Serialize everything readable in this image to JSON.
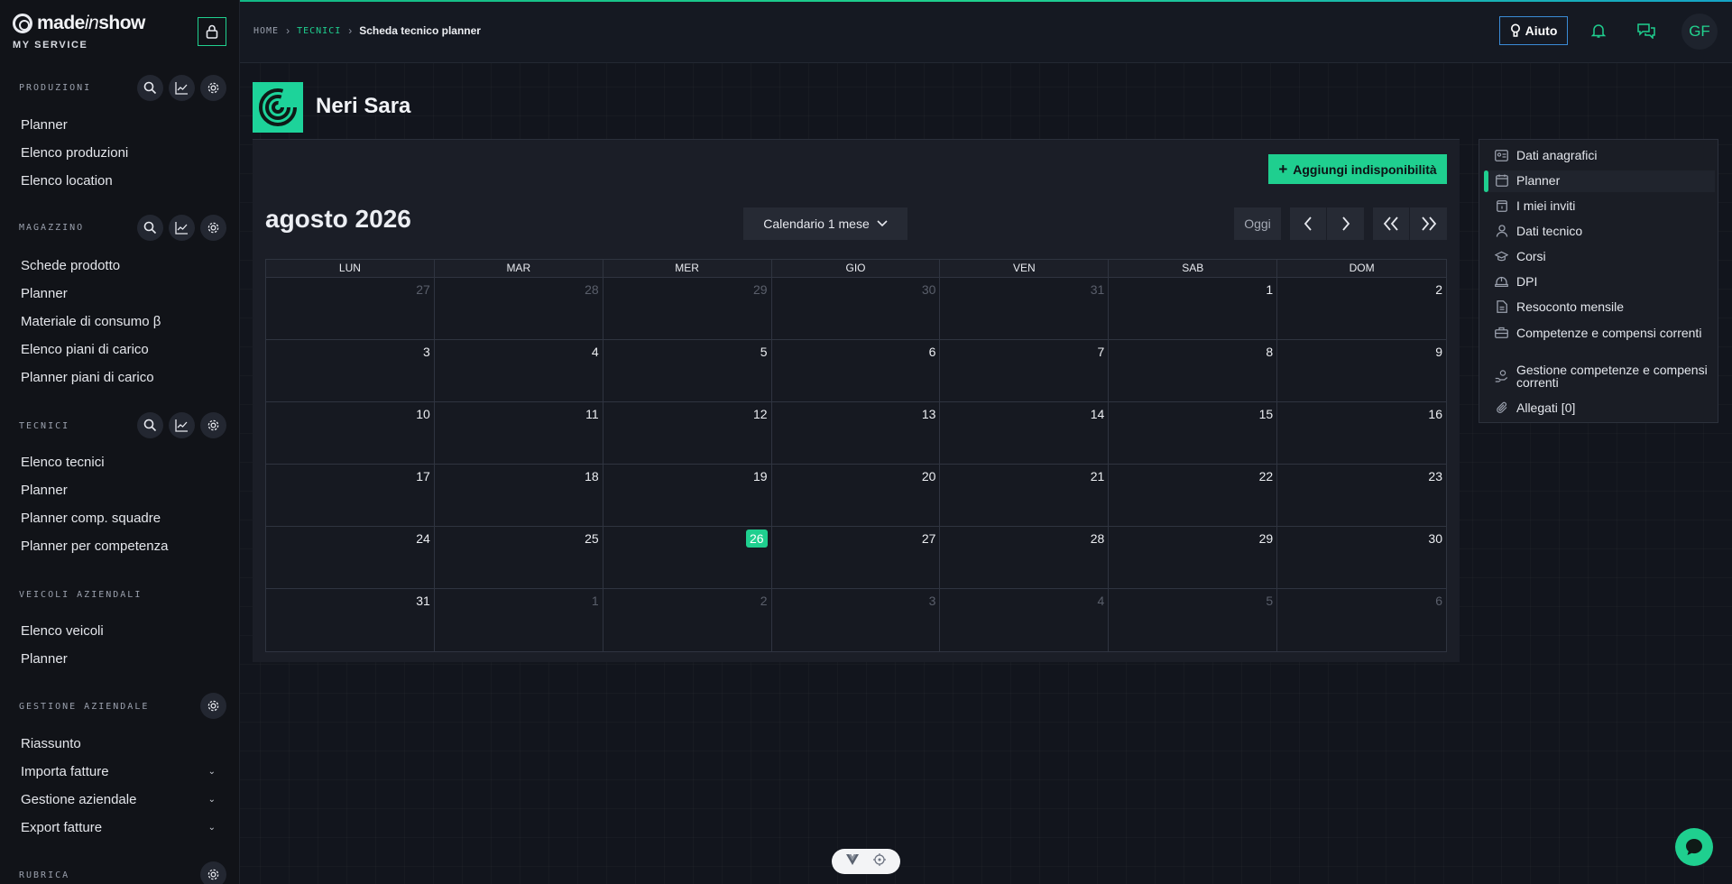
{
  "brand": {
    "name_bold": "made",
    "name_italic": "in",
    "name_end": "show",
    "subtitle": "MY SERVICE"
  },
  "sidebar": {
    "sections": [
      {
        "title": "PRODUZIONI",
        "items": [
          "Planner",
          "Elenco produzioni",
          "Elenco location"
        ]
      },
      {
        "title": "MAGAZZINO",
        "items": [
          "Schede prodotto",
          "Planner",
          "Materiale di consumo β",
          "Elenco piani di carico",
          "Planner piani di carico"
        ]
      },
      {
        "title": "TECNICI",
        "items": [
          "Elenco tecnici",
          "Planner",
          "Planner comp. squadre",
          "Planner per competenza"
        ]
      },
      {
        "title": "VEICOLI AZIENDALI",
        "items": [
          "Elenco veicoli",
          "Planner"
        ]
      },
      {
        "title": "GESTIONE AZIENDALE",
        "items": [
          "Riassunto",
          "Importa fatture",
          "Gestione aziendale",
          "Export fatture"
        ]
      },
      {
        "title": "RUBRICA"
      }
    ]
  },
  "breadcrumb": {
    "home": "HOME",
    "section": "TECNICI",
    "current": "Scheda tecnico planner"
  },
  "topbar": {
    "help_label": "Aiuto",
    "avatar_initials": "GF"
  },
  "profile": {
    "name": "Neri Sara"
  },
  "calendar": {
    "add_button": "Aggiungi indisponibilità",
    "month_title": "agosto 2026",
    "view_label": "Calendario 1 mese",
    "today_label": "Oggi",
    "weekdays": [
      "LUN",
      "MAR",
      "MER",
      "GIO",
      "VEN",
      "SAB",
      "DOM"
    ],
    "weeks": [
      [
        "27",
        "28",
        "29",
        "30",
        "31",
        "1",
        "2"
      ],
      [
        "3",
        "4",
        "5",
        "6",
        "7",
        "8",
        "9"
      ],
      [
        "10",
        "11",
        "12",
        "13",
        "14",
        "15",
        "16"
      ],
      [
        "17",
        "18",
        "19",
        "20",
        "21",
        "22",
        "23"
      ],
      [
        "24",
        "25",
        "26",
        "27",
        "28",
        "29",
        "30"
      ],
      [
        "31",
        "1",
        "2",
        "3",
        "4",
        "5",
        "6"
      ]
    ],
    "today": "26",
    "accent_color": "#1fcf8f"
  },
  "side_menu": {
    "items": [
      {
        "label": "Dati anagrafici",
        "icon": "id-card-icon"
      },
      {
        "label": "Planner",
        "icon": "calendar-icon",
        "active": true
      },
      {
        "label": "I miei inviti",
        "icon": "invite-icon"
      },
      {
        "label": "Dati tecnico",
        "icon": "person-icon"
      },
      {
        "label": "Corsi",
        "icon": "graduation-cap-icon"
      },
      {
        "label": "DPI",
        "icon": "helmet-icon"
      },
      {
        "label": "Resoconto mensile",
        "icon": "document-icon"
      },
      {
        "label": "Competenze e compensi correnti",
        "icon": "toolbox-icon"
      },
      {
        "label": "Gestione competenze e compensi correnti",
        "icon": "hand-coin-icon"
      },
      {
        "label": "Allegati [0]",
        "icon": "paperclip-icon"
      }
    ]
  }
}
